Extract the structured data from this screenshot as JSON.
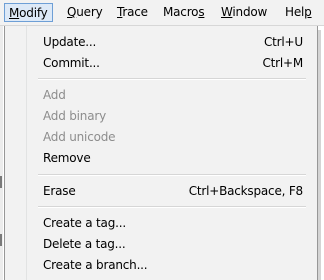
{
  "menubar": {
    "modify": {
      "ul": "M",
      "rest": "odify"
    },
    "query": {
      "ul": "Q",
      "rest": "uery"
    },
    "trace": {
      "ul": "T",
      "rest": "race"
    },
    "macros": {
      "pre": "Macro",
      "ul": "s"
    },
    "window": {
      "ul": "W",
      "rest": "indow"
    },
    "help": {
      "pre": "Hel",
      "ul": "p"
    }
  },
  "menu": {
    "update": {
      "label": "Update...",
      "shortcut": "Ctrl+U"
    },
    "commit": {
      "label": "Commit...",
      "shortcut": "Ctrl+M"
    },
    "add": {
      "label": "Add"
    },
    "add_binary": {
      "label": "Add binary"
    },
    "add_unicode": {
      "label": "Add unicode"
    },
    "remove": {
      "label": "Remove"
    },
    "erase": {
      "label": "Erase",
      "shortcut": "Ctrl+Backspace, F8"
    },
    "create_tag": {
      "label": "Create a tag..."
    },
    "delete_tag": {
      "label": "Delete a tag..."
    },
    "create_branch": {
      "label": "Create a branch..."
    }
  }
}
